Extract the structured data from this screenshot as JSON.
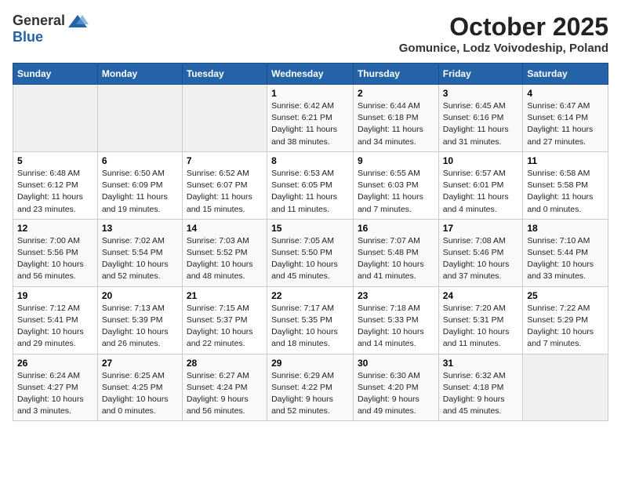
{
  "header": {
    "logo_general": "General",
    "logo_blue": "Blue",
    "month_title": "October 2025",
    "subtitle": "Gomunice, Lodz Voivodeship, Poland"
  },
  "days_of_week": [
    "Sunday",
    "Monday",
    "Tuesday",
    "Wednesday",
    "Thursday",
    "Friday",
    "Saturday"
  ],
  "weeks": [
    [
      {
        "day": "",
        "info": ""
      },
      {
        "day": "",
        "info": ""
      },
      {
        "day": "",
        "info": ""
      },
      {
        "day": "1",
        "info": "Sunrise: 6:42 AM\nSunset: 6:21 PM\nDaylight: 11 hours\nand 38 minutes."
      },
      {
        "day": "2",
        "info": "Sunrise: 6:44 AM\nSunset: 6:18 PM\nDaylight: 11 hours\nand 34 minutes."
      },
      {
        "day": "3",
        "info": "Sunrise: 6:45 AM\nSunset: 6:16 PM\nDaylight: 11 hours\nand 31 minutes."
      },
      {
        "day": "4",
        "info": "Sunrise: 6:47 AM\nSunset: 6:14 PM\nDaylight: 11 hours\nand 27 minutes."
      }
    ],
    [
      {
        "day": "5",
        "info": "Sunrise: 6:48 AM\nSunset: 6:12 PM\nDaylight: 11 hours\nand 23 minutes."
      },
      {
        "day": "6",
        "info": "Sunrise: 6:50 AM\nSunset: 6:09 PM\nDaylight: 11 hours\nand 19 minutes."
      },
      {
        "day": "7",
        "info": "Sunrise: 6:52 AM\nSunset: 6:07 PM\nDaylight: 11 hours\nand 15 minutes."
      },
      {
        "day": "8",
        "info": "Sunrise: 6:53 AM\nSunset: 6:05 PM\nDaylight: 11 hours\nand 11 minutes."
      },
      {
        "day": "9",
        "info": "Sunrise: 6:55 AM\nSunset: 6:03 PM\nDaylight: 11 hours\nand 7 minutes."
      },
      {
        "day": "10",
        "info": "Sunrise: 6:57 AM\nSunset: 6:01 PM\nDaylight: 11 hours\nand 4 minutes."
      },
      {
        "day": "11",
        "info": "Sunrise: 6:58 AM\nSunset: 5:58 PM\nDaylight: 11 hours\nand 0 minutes."
      }
    ],
    [
      {
        "day": "12",
        "info": "Sunrise: 7:00 AM\nSunset: 5:56 PM\nDaylight: 10 hours\nand 56 minutes."
      },
      {
        "day": "13",
        "info": "Sunrise: 7:02 AM\nSunset: 5:54 PM\nDaylight: 10 hours\nand 52 minutes."
      },
      {
        "day": "14",
        "info": "Sunrise: 7:03 AM\nSunset: 5:52 PM\nDaylight: 10 hours\nand 48 minutes."
      },
      {
        "day": "15",
        "info": "Sunrise: 7:05 AM\nSunset: 5:50 PM\nDaylight: 10 hours\nand 45 minutes."
      },
      {
        "day": "16",
        "info": "Sunrise: 7:07 AM\nSunset: 5:48 PM\nDaylight: 10 hours\nand 41 minutes."
      },
      {
        "day": "17",
        "info": "Sunrise: 7:08 AM\nSunset: 5:46 PM\nDaylight: 10 hours\nand 37 minutes."
      },
      {
        "day": "18",
        "info": "Sunrise: 7:10 AM\nSunset: 5:44 PM\nDaylight: 10 hours\nand 33 minutes."
      }
    ],
    [
      {
        "day": "19",
        "info": "Sunrise: 7:12 AM\nSunset: 5:41 PM\nDaylight: 10 hours\nand 29 minutes."
      },
      {
        "day": "20",
        "info": "Sunrise: 7:13 AM\nSunset: 5:39 PM\nDaylight: 10 hours\nand 26 minutes."
      },
      {
        "day": "21",
        "info": "Sunrise: 7:15 AM\nSunset: 5:37 PM\nDaylight: 10 hours\nand 22 minutes."
      },
      {
        "day": "22",
        "info": "Sunrise: 7:17 AM\nSunset: 5:35 PM\nDaylight: 10 hours\nand 18 minutes."
      },
      {
        "day": "23",
        "info": "Sunrise: 7:18 AM\nSunset: 5:33 PM\nDaylight: 10 hours\nand 14 minutes."
      },
      {
        "day": "24",
        "info": "Sunrise: 7:20 AM\nSunset: 5:31 PM\nDaylight: 10 hours\nand 11 minutes."
      },
      {
        "day": "25",
        "info": "Sunrise: 7:22 AM\nSunset: 5:29 PM\nDaylight: 10 hours\nand 7 minutes."
      }
    ],
    [
      {
        "day": "26",
        "info": "Sunrise: 6:24 AM\nSunset: 4:27 PM\nDaylight: 10 hours\nand 3 minutes."
      },
      {
        "day": "27",
        "info": "Sunrise: 6:25 AM\nSunset: 4:25 PM\nDaylight: 10 hours\nand 0 minutes."
      },
      {
        "day": "28",
        "info": "Sunrise: 6:27 AM\nSunset: 4:24 PM\nDaylight: 9 hours\nand 56 minutes."
      },
      {
        "day": "29",
        "info": "Sunrise: 6:29 AM\nSunset: 4:22 PM\nDaylight: 9 hours\nand 52 minutes."
      },
      {
        "day": "30",
        "info": "Sunrise: 6:30 AM\nSunset: 4:20 PM\nDaylight: 9 hours\nand 49 minutes."
      },
      {
        "day": "31",
        "info": "Sunrise: 6:32 AM\nSunset: 4:18 PM\nDaylight: 9 hours\nand 45 minutes."
      },
      {
        "day": "",
        "info": ""
      }
    ]
  ]
}
